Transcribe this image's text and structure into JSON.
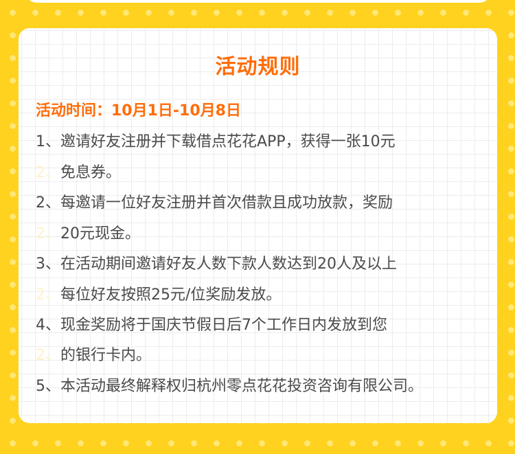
{
  "rules": {
    "title": "活动规则",
    "time": "活动时间：10月1日-10月8日",
    "lines": [
      "1、邀请好友注册并下载借点花花APP，获得一张10元",
      "免息券。",
      "2、每邀请一位好友注册并首次借款且成功放款，奖励",
      "20元现金。",
      "3、在活动期间邀请好友人数下款人数达到20人及以上",
      "每位好友按照25元/位奖励发放。",
      "4、现金奖励将于国庆节假日后7个工作日内发放到您",
      "的银行卡内。",
      "5、本活动最终解释权归杭州零点花花投资咨询有限公司。"
    ],
    "ghost_marker": "2、"
  },
  "colors": {
    "background": "#ffd21f",
    "accent": "#ff6d0b",
    "text": "#4a4a4a"
  }
}
